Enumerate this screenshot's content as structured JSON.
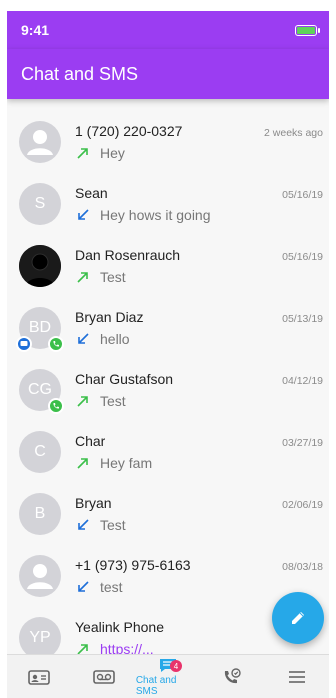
{
  "status_bar": {
    "time": "9:41"
  },
  "header": {
    "title": "Chat and SMS"
  },
  "conversations": [
    {
      "name": "1 (720) 220-0327",
      "date": "2 weeks ago",
      "message": "Hey",
      "direction": "outgoing",
      "avatar_initials": ""
    },
    {
      "name": "Sean",
      "date": "05/16/19",
      "message": "Hey hows it going",
      "direction": "incoming",
      "avatar_initials": "S"
    },
    {
      "name": "Dan Rosenrauch",
      "date": "05/16/19",
      "message": "Test",
      "direction": "outgoing",
      "avatar_initials": ""
    },
    {
      "name": "Bryan Diaz",
      "date": "05/13/19",
      "message": "hello",
      "direction": "incoming",
      "avatar_initials": "BD"
    },
    {
      "name": "Char Gustafson",
      "date": "04/12/19",
      "message": "Test",
      "direction": "outgoing",
      "avatar_initials": "CG"
    },
    {
      "name": "Char",
      "date": "03/27/19",
      "message": "Hey fam",
      "direction": "outgoing",
      "avatar_initials": "C"
    },
    {
      "name": "Bryan",
      "date": "02/06/19",
      "message": "Test",
      "direction": "incoming",
      "avatar_initials": "B"
    },
    {
      "name": "+1 (973) 975-6163",
      "date": "08/03/18",
      "message": "test",
      "direction": "incoming",
      "avatar_initials": ""
    },
    {
      "name": "Yealink Phone",
      "date": "",
      "message": "https://...",
      "direction": "outgoing",
      "avatar_initials": "YP"
    }
  ],
  "tabbar": {
    "active_label": "Chat and SMS",
    "chat_badge": "4"
  },
  "colors": {
    "brand": "#9b3df2",
    "accent": "#26a8e8",
    "outgoing": "#3bbf4a",
    "incoming": "#1e6fd9"
  }
}
